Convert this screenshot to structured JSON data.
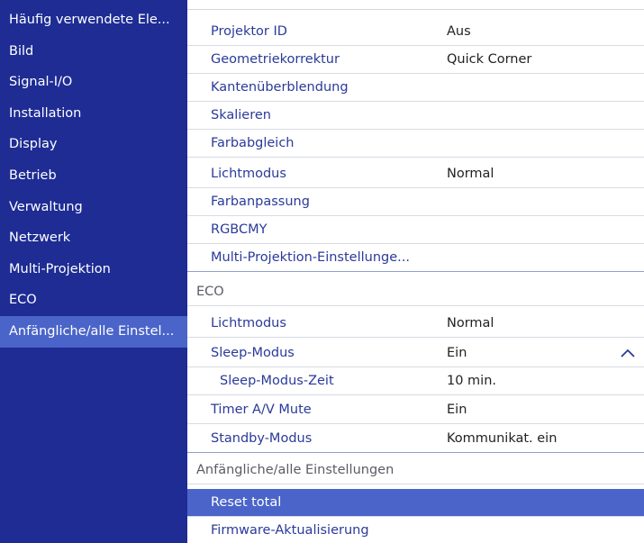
{
  "sidebar": {
    "items": [
      {
        "label": "Häufig verwendete Ele..."
      },
      {
        "label": "Bild"
      },
      {
        "label": "Signal-I/O"
      },
      {
        "label": "Installation"
      },
      {
        "label": "Display"
      },
      {
        "label": "Betrieb"
      },
      {
        "label": "Verwaltung"
      },
      {
        "label": "Netzwerk"
      },
      {
        "label": "Multi-Projektion"
      },
      {
        "label": "ECO"
      },
      {
        "label": "Anfängliche/alle Einstel..."
      }
    ],
    "selected_index": 10
  },
  "main": {
    "rows": [
      {
        "label": "Projektor ID",
        "value": "Aus"
      },
      {
        "label": "Geometriekorrektur",
        "value": "Quick Corner"
      },
      {
        "label": "Kantenüberblendung",
        "value": ""
      },
      {
        "label": "Skalieren",
        "value": ""
      },
      {
        "label": "Farbabgleich",
        "value": ""
      },
      {
        "label": "Lichtmodus",
        "value": "Normal"
      },
      {
        "label": "Farbanpassung",
        "value": ""
      },
      {
        "label": "RGBCMY",
        "value": ""
      },
      {
        "label": "Multi-Projektion-Einstellunge...",
        "value": ""
      }
    ],
    "eco_header": "ECO",
    "eco_rows": [
      {
        "label": "Lichtmodus",
        "value": "Normal"
      },
      {
        "label": "Sleep-Modus",
        "value": "Ein"
      },
      {
        "label": "Sleep-Modus-Zeit",
        "value": "10 min."
      },
      {
        "label": "Timer A/V Mute",
        "value": "Ein"
      },
      {
        "label": "Standby-Modus",
        "value": "Kommunikat. ein"
      }
    ],
    "initial_header": "Anfängliche/alle Einstellungen",
    "initial_rows": [
      {
        "label": "Reset total"
      },
      {
        "label": "Firmware-Aktualisierung"
      }
    ]
  },
  "colors": {
    "sidebar_bg": "#1e2c94",
    "selected_bg": "#4a64c9",
    "item_text": "#2a3a9a"
  },
  "icons": {
    "sleep_expand": "chevron-up-icon"
  }
}
